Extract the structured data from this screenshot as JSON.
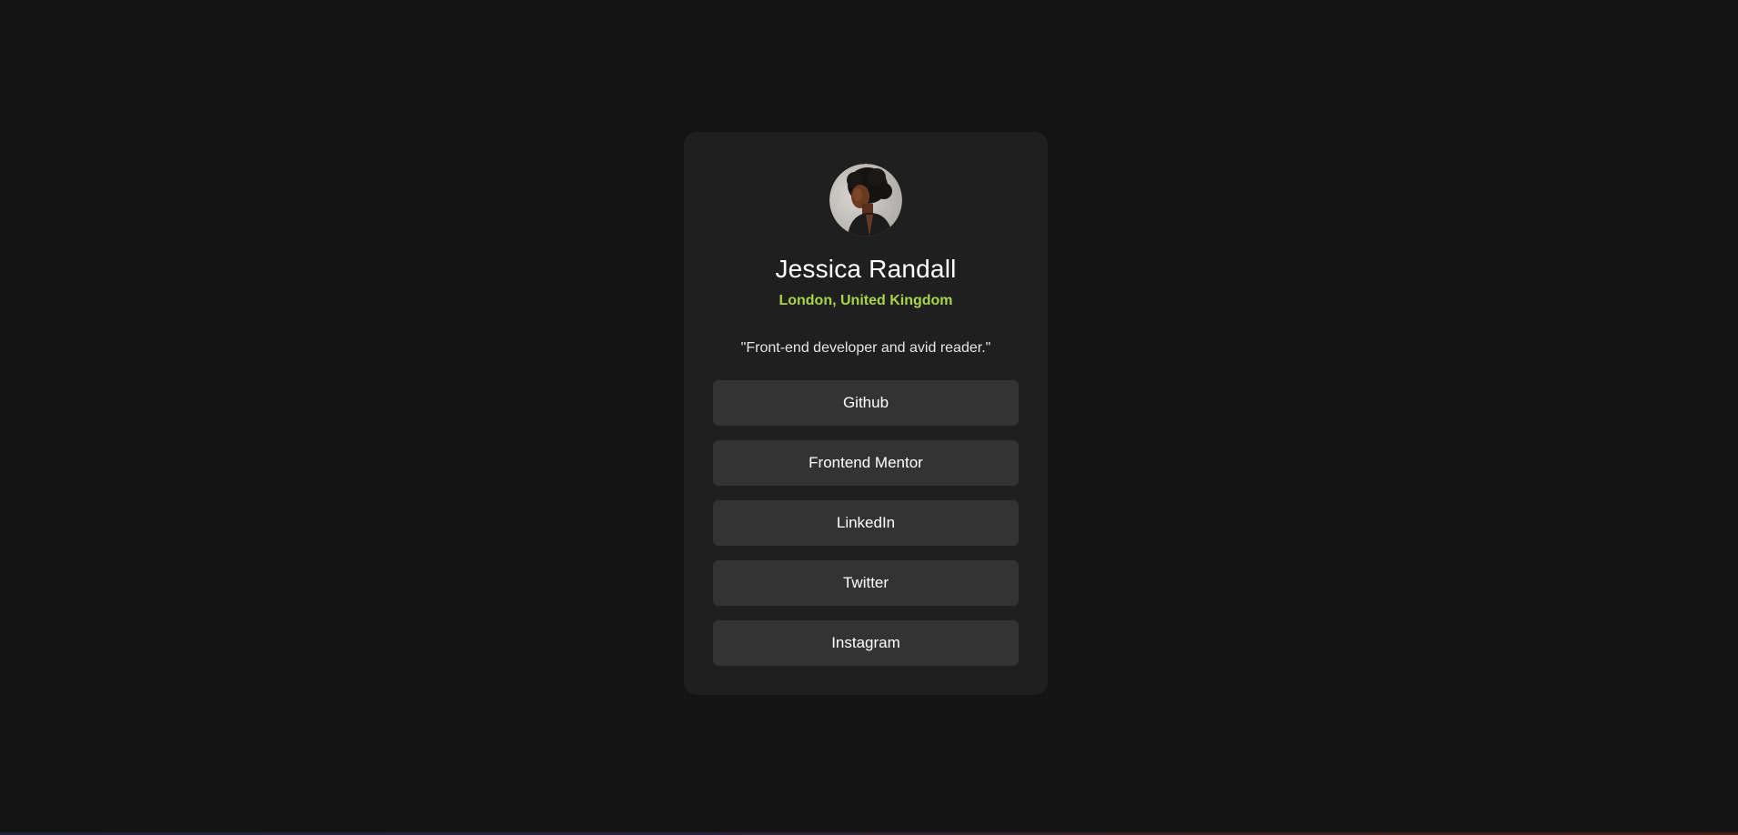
{
  "profile": {
    "name": "Jessica Randall",
    "location": "London, United Kingdom",
    "bio": "\"Front-end developer and avid reader.\"",
    "avatar_icon": "avatar-photo"
  },
  "links": [
    {
      "label": "Github"
    },
    {
      "label": "Frontend Mentor"
    },
    {
      "label": "LinkedIn"
    },
    {
      "label": "Twitter"
    },
    {
      "label": "Instagram"
    }
  ],
  "colors": {
    "page_background": "#141414",
    "card_background": "#1f1f1f",
    "button_background": "#333333",
    "accent": "#a8d34a",
    "text": "#ffffff"
  }
}
